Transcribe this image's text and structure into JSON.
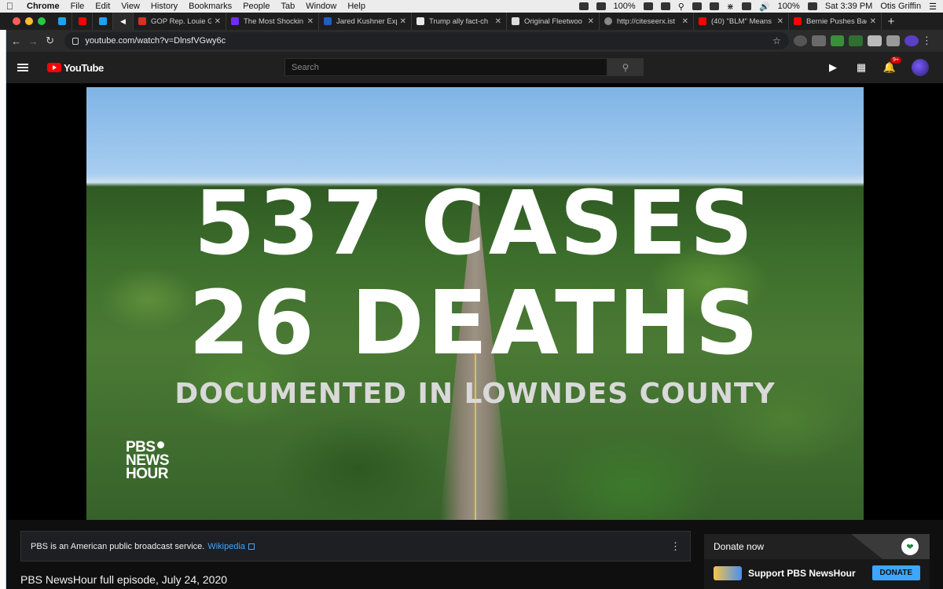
{
  "menubar": {
    "app": "Chrome",
    "items": [
      "File",
      "Edit",
      "View",
      "History",
      "Bookmarks",
      "People",
      "Tab",
      "Window",
      "Help"
    ],
    "battery": "100%",
    "battery2": "100%",
    "clock": "Sat 3:39 PM",
    "user": "Otis Griffin"
  },
  "tabs": [
    {
      "title": "GOP Rep. Louie G",
      "color": "#d93025"
    },
    {
      "title": "The Most Shockin",
      "color": "#6f2cff"
    },
    {
      "title": "Jared Kushner Exp",
      "color": "#1f5fbf"
    },
    {
      "title": "Trump ally fact-ch",
      "color": "#e8e8e8"
    },
    {
      "title": "Original Fleetwoo",
      "color": "#dddddd"
    },
    {
      "title": "http://citeseerx.ist",
      "color": "#888888"
    },
    {
      "title": "(40) \"BLM\" Means",
      "color": "#ff0000"
    },
    {
      "title": "Bernie Pushes Bac",
      "color": "#ff0000"
    }
  ],
  "address": {
    "url": "youtube.com/watch?v=DlnsfVGwy6c"
  },
  "youtube": {
    "logo": "YouTube",
    "search_placeholder": "Search",
    "notif_badge": "9+"
  },
  "video": {
    "line1": "537 CASES",
    "line2": "26 DEATHS",
    "line3": "DOCUMENTED IN LOWNDES COUNTY",
    "brand_1": "PBS",
    "brand_2": "NEWS",
    "brand_3": "HOUR"
  },
  "info": {
    "text": "PBS is an American public broadcast service.",
    "link": "Wikipedia"
  },
  "video_title": "PBS NewsHour full episode, July 24, 2020",
  "donate": {
    "header": "Donate now",
    "support": "Support PBS NewsHour",
    "button": "DONATE"
  }
}
